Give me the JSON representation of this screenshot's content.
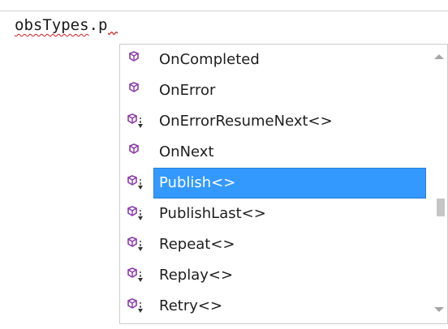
{
  "editor": {
    "code_squiggled": "obsTypes",
    "code_dot": ".",
    "code_typed": "p"
  },
  "completion_list": {
    "selected_index": 4,
    "scroll_position_fraction": 0.62,
    "items": [
      {
        "label": "OnCompleted",
        "icon": "method-icon"
      },
      {
        "label": "OnError",
        "icon": "method-icon"
      },
      {
        "label": "OnErrorResumeNext<>",
        "icon": "extension-method-icon"
      },
      {
        "label": "OnNext",
        "icon": "method-icon"
      },
      {
        "label": "Publish<>",
        "icon": "extension-method-icon"
      },
      {
        "label": "PublishLast<>",
        "icon": "extension-method-icon"
      },
      {
        "label": "Repeat<>",
        "icon": "extension-method-icon"
      },
      {
        "label": "Replay<>",
        "icon": "extension-method-icon"
      },
      {
        "label": "Retry<>",
        "icon": "extension-method-icon"
      }
    ]
  },
  "colors": {
    "selection": "#3399ff",
    "method_icon": "#8a3aa8",
    "squiggle": "#d02020"
  }
}
